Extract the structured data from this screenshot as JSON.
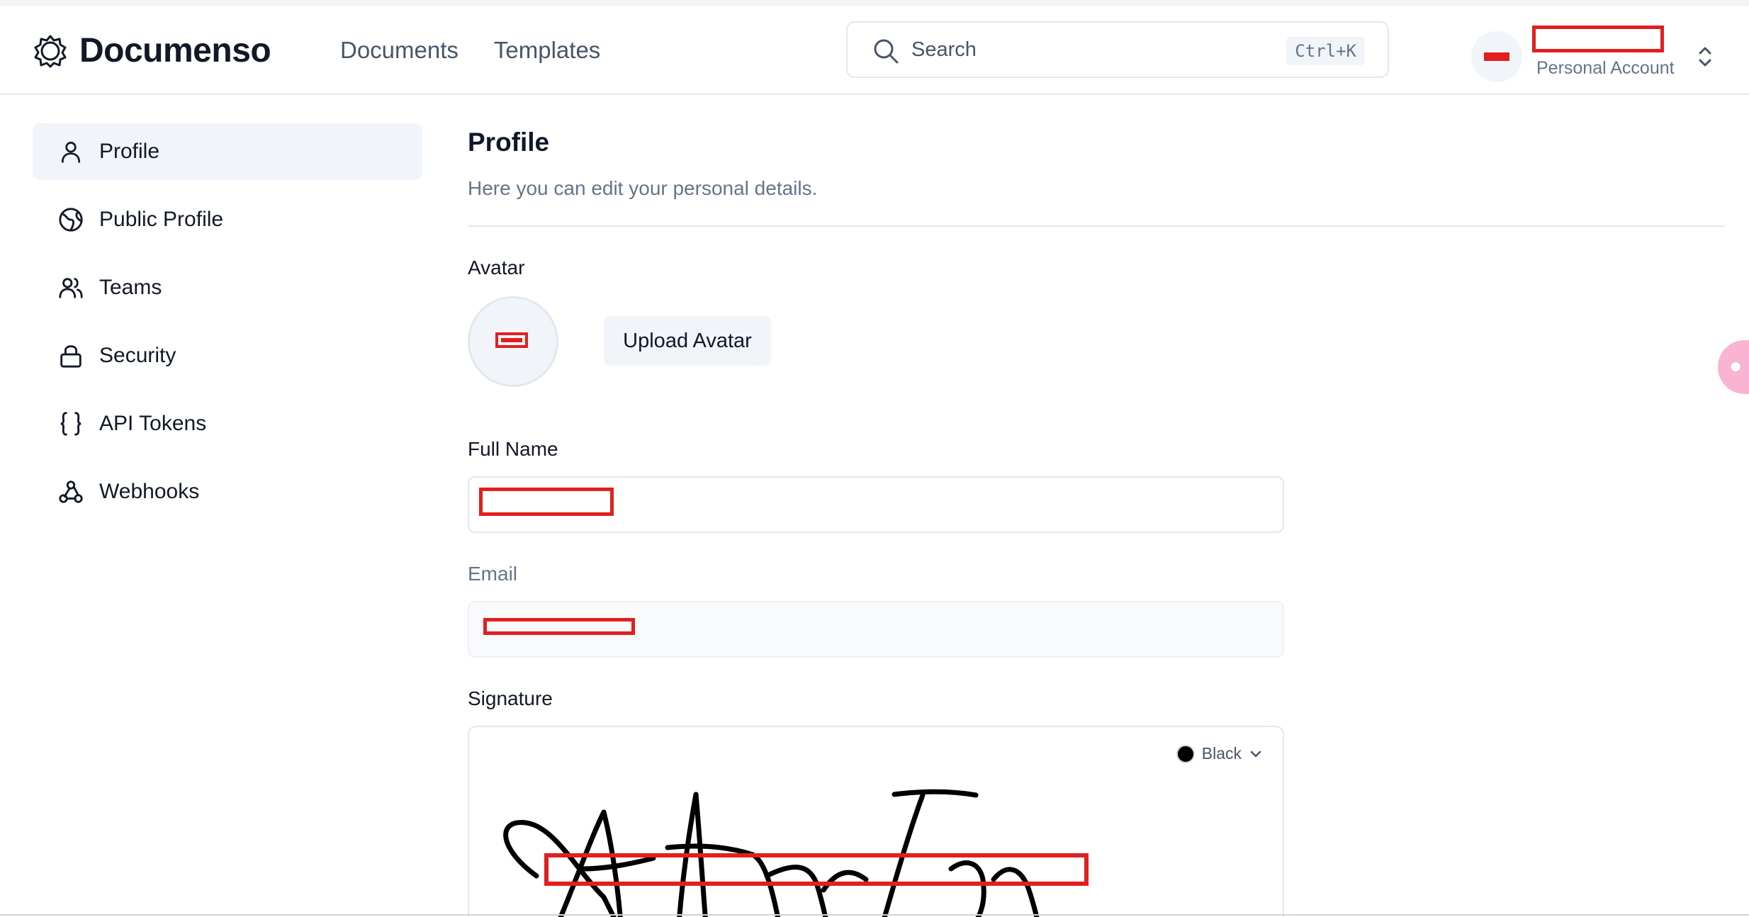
{
  "header": {
    "brand": "Documenso",
    "nav": [
      "Documents",
      "Templates"
    ],
    "search": {
      "placeholder": "Search",
      "shortcut": "Ctrl+K"
    },
    "account": {
      "subtitle": "Personal Account"
    }
  },
  "sidebar": {
    "items": [
      {
        "label": "Profile",
        "icon": "user-icon",
        "active": true
      },
      {
        "label": "Public Profile",
        "icon": "globe-icon",
        "active": false
      },
      {
        "label": "Teams",
        "icon": "users-icon",
        "active": false
      },
      {
        "label": "Security",
        "icon": "lock-icon",
        "active": false
      },
      {
        "label": "API Tokens",
        "icon": "braces-icon",
        "active": false
      },
      {
        "label": "Webhooks",
        "icon": "webhook-icon",
        "active": false
      }
    ]
  },
  "main": {
    "title": "Profile",
    "subtitle": "Here you can edit your personal details.",
    "avatar_label": "Avatar",
    "upload_label": "Upload Avatar",
    "full_name_label": "Full Name",
    "email_label": "Email",
    "signature_label": "Signature",
    "signature_color": "Black"
  },
  "colors": {
    "accent_bg": "#f1f5f9",
    "text": "#0f172a",
    "muted": "#64748b",
    "redaction": "#e02020"
  }
}
